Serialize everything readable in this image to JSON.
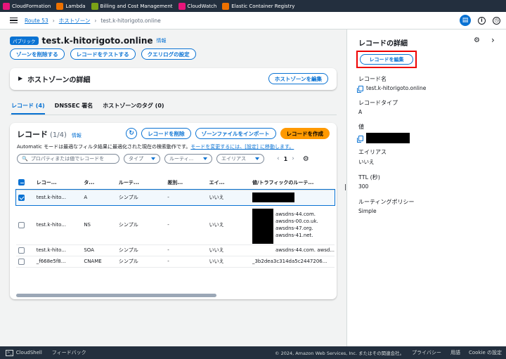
{
  "topbar": {
    "favorites": [
      {
        "label": "CloudFormation",
        "color": "#e7157b"
      },
      {
        "label": "Lambda",
        "color": "#ed7100"
      },
      {
        "label": "Billing and Cost Management",
        "color": "#7aa116"
      },
      {
        "label": "CloudWatch",
        "color": "#e7157b"
      },
      {
        "label": "Elastic Container Registry",
        "color": "#ed7100"
      }
    ]
  },
  "breadcrumb": {
    "root": "Route 53",
    "parent": "ホストゾーン",
    "current": "test.k-hitorigoto.online"
  },
  "header": {
    "badge": "パブリック",
    "title": "test.k-hitorigoto.online",
    "info": "情報",
    "buttons": {
      "delete_zone": "ゾーンを削除する",
      "test_record": "レコードをテストする",
      "query_log": "クエリログの設定"
    }
  },
  "zone_details": {
    "title": "ホストゾーンの詳細",
    "edit_button": "ホストゾーンを編集"
  },
  "tabs": [
    "レコード (4)",
    "DNSSEC 署名",
    "ホストゾーンのタグ (0)"
  ],
  "records": {
    "title": "レコード",
    "count": "(1/4)",
    "info": "情報",
    "delete_button": "レコードを削除",
    "import_button": "ゾーンファイルをインポート",
    "create_button": "レコードを作成",
    "notice": "Automatic モードは最適なフィルタ結果に最適化された現在の検索動作です。",
    "notice_link": "モードを変更するには、[設定] に移動します。",
    "search_placeholder": "プロパティまたは値でレコードを",
    "filter_type": "タイプ",
    "filter_routing": "ルーティ...",
    "filter_alias": "エイリアス",
    "page": "1",
    "columns": [
      "レコー...",
      "タ...",
      "ルーテ...",
      "差別...",
      "エイ...",
      "値/トラフィックのルーテ..."
    ],
    "rows": [
      {
        "name": "test.k-hito...",
        "type": "A",
        "routing": "シンプル",
        "diff": "-",
        "alias": "いいえ",
        "values": []
      },
      {
        "name": "test.k-hito...",
        "type": "NS",
        "routing": "シンプル",
        "diff": "-",
        "alias": "いいえ",
        "values": [
          "awsdns-44.com.",
          "awsdns-00.co.uk.",
          "awsdns-47.org.",
          "awsdns-41.net."
        ]
      },
      {
        "name": "test.k-hito...",
        "type": "SOA",
        "routing": "シンプル",
        "diff": "-",
        "alias": "いいえ",
        "values": [
          "awsdns-44.com. awsd..."
        ]
      },
      {
        "name": "_f668e5f8...",
        "type": "CNAME",
        "routing": "シンプル",
        "diff": "-",
        "alias": "いいえ",
        "values": [
          "_3b2dea3c314da5c2447206..."
        ]
      }
    ]
  },
  "side": {
    "title": "レコードの詳細",
    "edit_button": "レコードを編集",
    "fields": {
      "name_label": "レコード名",
      "name_value": "test.k-hitorigoto.online",
      "type_label": "レコードタイプ",
      "type_value": "A",
      "value_label": "値",
      "alias_label": "エイリアス",
      "alias_value": "いいえ",
      "ttl_label": "TTL (秒)",
      "ttl_value": "300",
      "policy_label": "ルーティングポリシー",
      "policy_value": "Simple"
    }
  },
  "footer": {
    "cloudshell": "CloudShell",
    "feedback": "フィードバック",
    "copyright": "© 2024, Amazon Web Services, Inc. またはその関連会社。",
    "privacy": "プライバシー",
    "terms": "用語",
    "cookie": "Cookie の設定"
  }
}
